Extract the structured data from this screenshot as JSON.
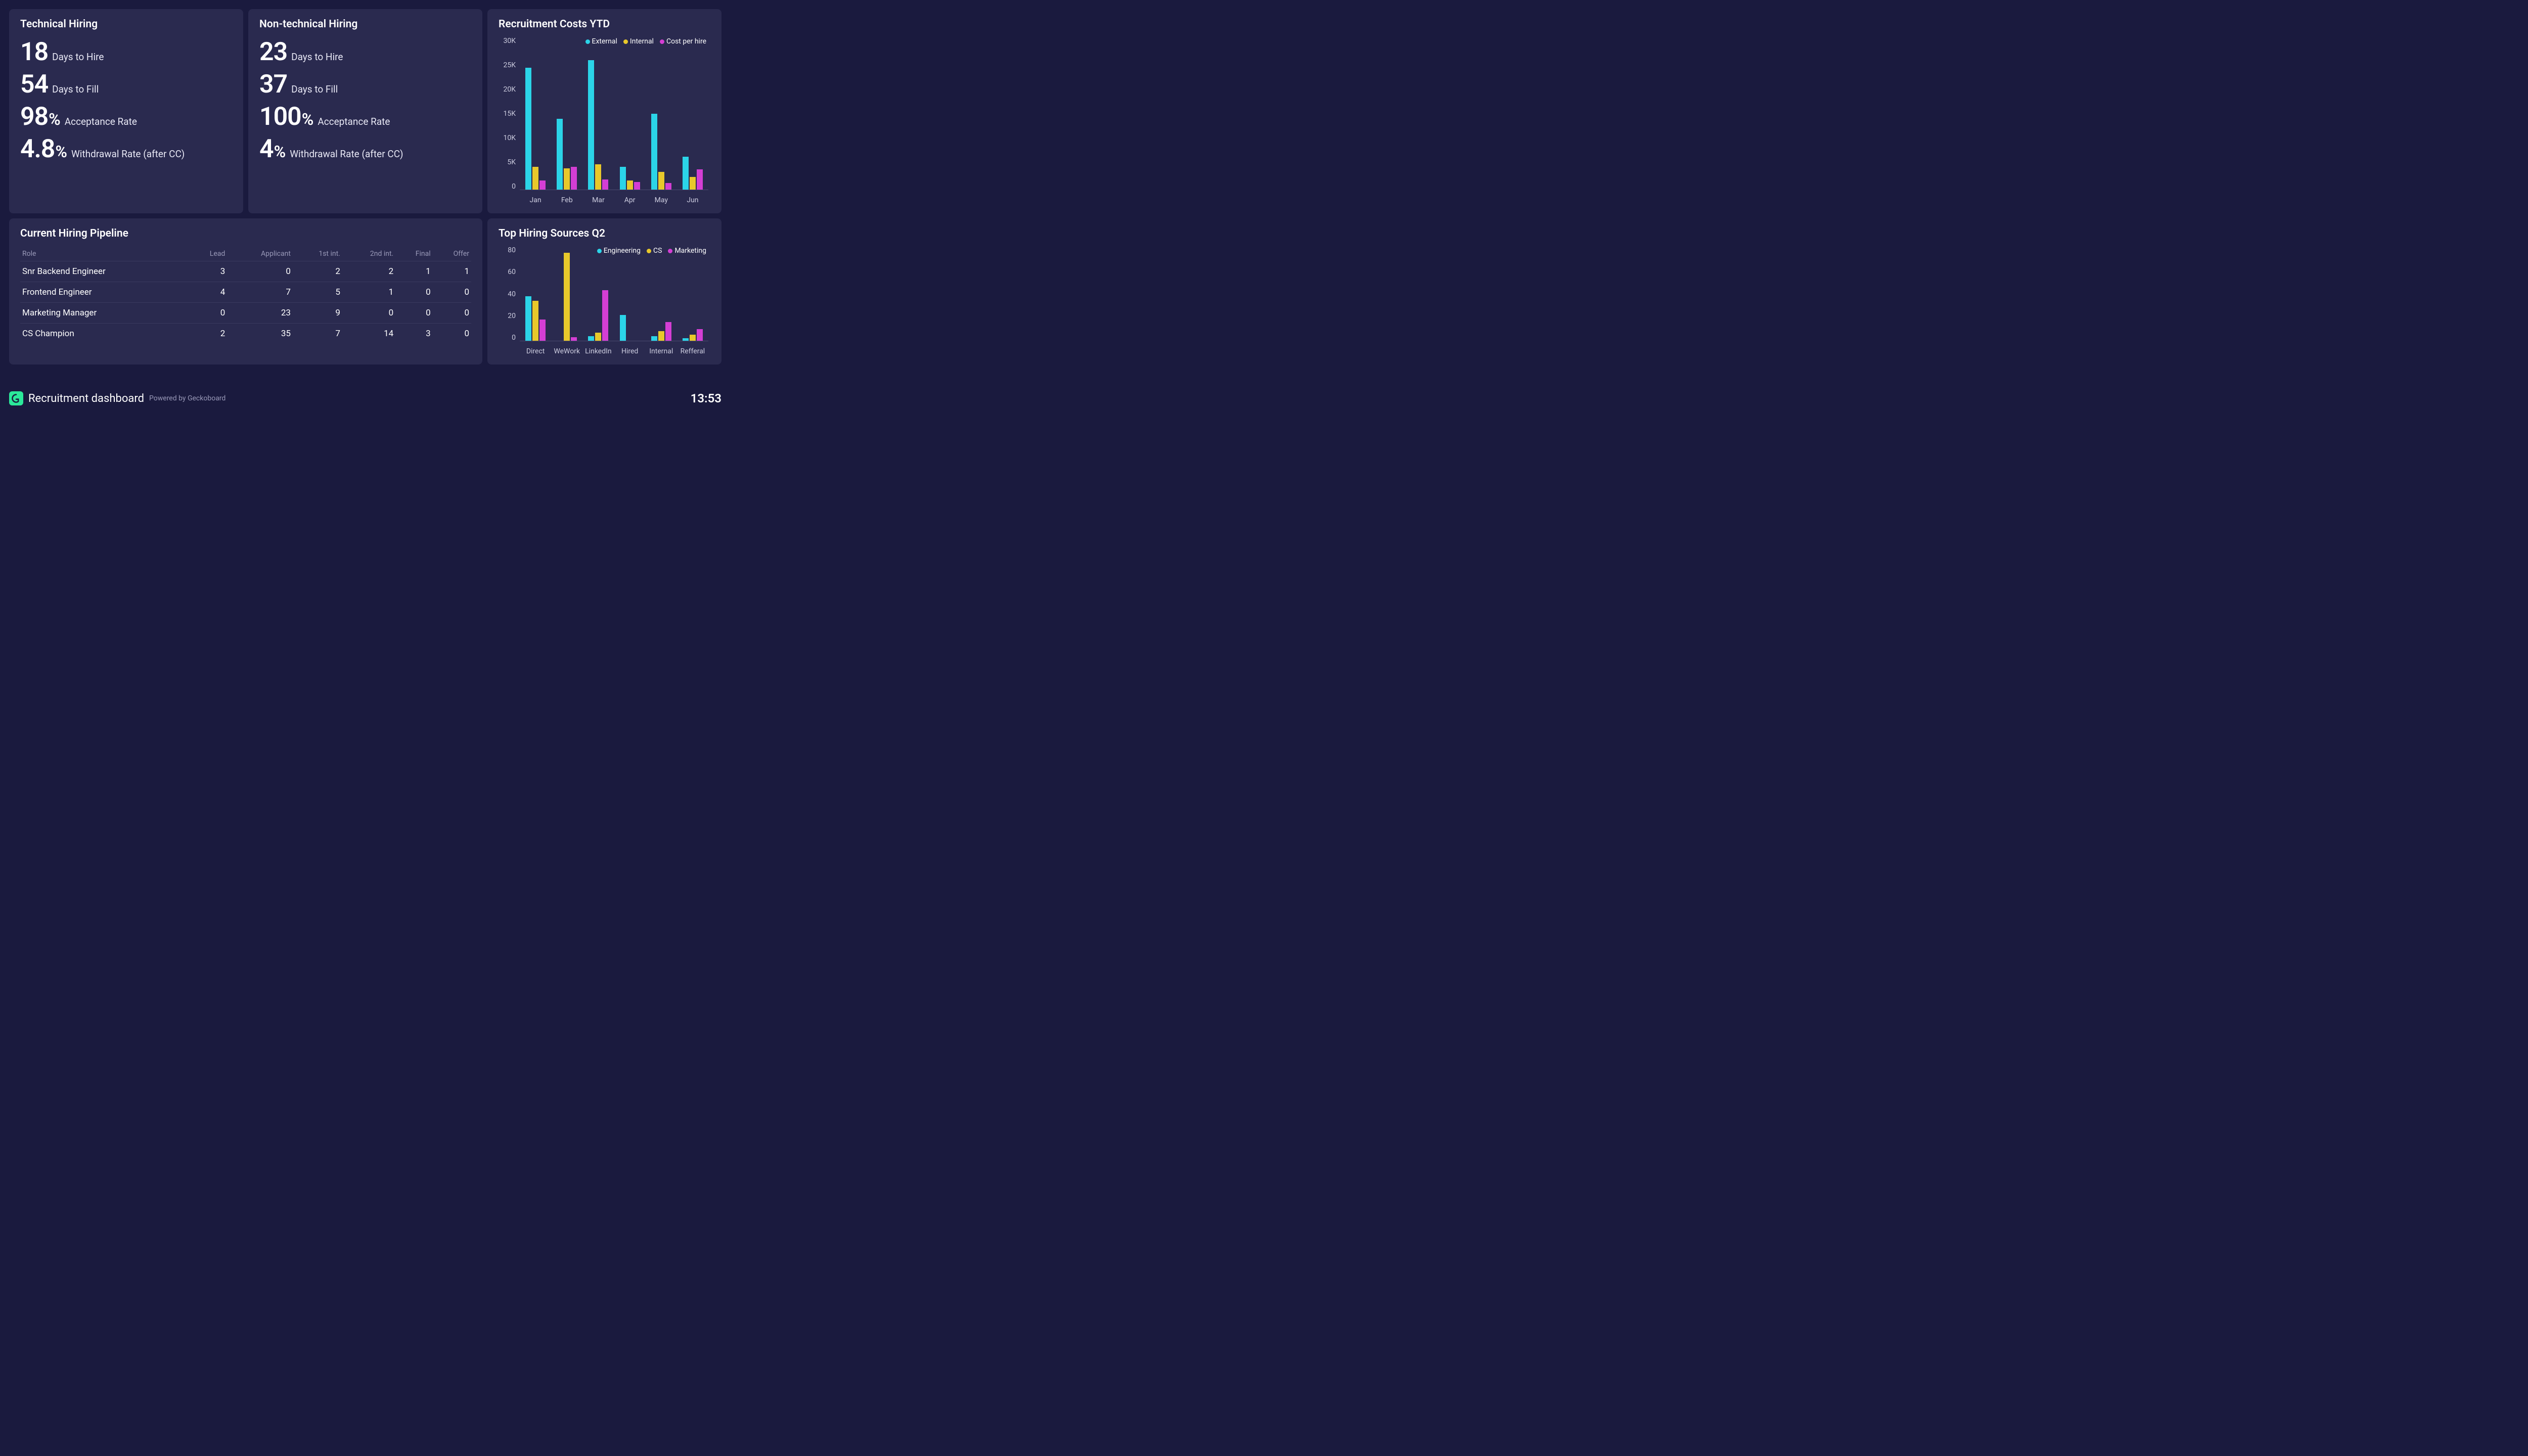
{
  "technical": {
    "title": "Technical Hiring",
    "stats": [
      {
        "num": "18",
        "unit": "",
        "label": "Days to Hire"
      },
      {
        "num": "54",
        "unit": "",
        "label": "Days to Fill"
      },
      {
        "num": "98",
        "unit": "%",
        "label": "Acceptance Rate"
      },
      {
        "num": "4.8",
        "unit": "%",
        "label": "Withdrawal Rate (after CC)"
      }
    ]
  },
  "nontechnical": {
    "title": "Non-technical Hiring",
    "stats": [
      {
        "num": "23",
        "unit": "",
        "label": "Days to Hire"
      },
      {
        "num": "37",
        "unit": "",
        "label": "Days to Fill"
      },
      {
        "num": "100",
        "unit": "%",
        "label": "Acceptance Rate"
      },
      {
        "num": "4",
        "unit": "%",
        "label": "Withdrawal Rate (after CC)"
      }
    ]
  },
  "costs": {
    "title": "Recruitment Costs YTD"
  },
  "pipeline": {
    "title": "Current Hiring Pipeline",
    "headers": [
      "Role",
      "Lead",
      "Applicant",
      "1st int.",
      "2nd int.",
      "Final",
      "Offer"
    ],
    "rows": [
      [
        "Snr Backend Engineer",
        "3",
        "0",
        "2",
        "2",
        "1",
        "1"
      ],
      [
        "Frontend Engineer",
        "4",
        "7",
        "5",
        "1",
        "0",
        "0"
      ],
      [
        "Marketing Manager",
        "0",
        "23",
        "9",
        "0",
        "0",
        "0"
      ],
      [
        "CS Champion",
        "2",
        "35",
        "7",
        "14",
        "3",
        "0"
      ]
    ]
  },
  "sources": {
    "title": "Top Hiring Sources Q2"
  },
  "footer": {
    "title": "Recruitment dashboard",
    "powered": "Powered by Geckoboard",
    "clock": "13:53"
  },
  "chart_data": [
    {
      "type": "bar",
      "title": "Recruitment Costs YTD",
      "categories": [
        "Jan",
        "Feb",
        "Mar",
        "Apr",
        "May",
        "Jun"
      ],
      "series": [
        {
          "name": "External",
          "color": "#2bd4e8",
          "values": [
            24000,
            14000,
            25500,
            4500,
            15000,
            6500
          ]
        },
        {
          "name": "Internal",
          "color": "#e8c82b",
          "values": [
            4500,
            4200,
            5000,
            1800,
            3500,
            2500
          ]
        },
        {
          "name": "Cost per hire",
          "color": "#d43ed4",
          "values": [
            1800,
            4500,
            2000,
            1500,
            1300,
            4000
          ]
        }
      ],
      "ylim": [
        0,
        30000
      ],
      "yticks": [
        "30K",
        "25K",
        "20K",
        "15K",
        "10K",
        "5K",
        "0"
      ],
      "legend_labels": [
        "External",
        "Internal",
        "Cost per hire"
      ]
    },
    {
      "type": "bar",
      "title": "Top Hiring Sources Q2",
      "categories": [
        "Direct",
        "WeWork",
        "LinkedIn",
        "Hired",
        "Internal",
        "Refferal"
      ],
      "series": [
        {
          "name": "Engineering",
          "color": "#2bd4e8",
          "values": [
            38,
            0,
            4,
            22,
            4,
            2
          ]
        },
        {
          "name": "CS",
          "color": "#e8c82b",
          "values": [
            34,
            75,
            7,
            0,
            8,
            5
          ]
        },
        {
          "name": "Marketing",
          "color": "#d43ed4",
          "values": [
            18,
            3,
            43,
            0,
            16,
            10
          ]
        }
      ],
      "ylim": [
        0,
        80
      ],
      "yticks": [
        "80",
        "60",
        "40",
        "20",
        "0"
      ],
      "legend_labels": [
        "Engineering",
        "CS",
        "Marketing"
      ]
    }
  ]
}
